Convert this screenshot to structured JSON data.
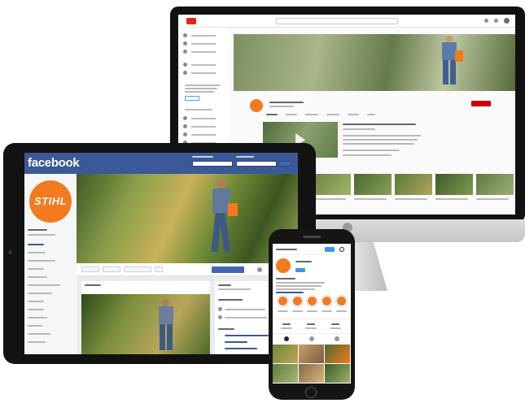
{
  "facebook": {
    "logo_text": "facebook"
  },
  "brand": {
    "badge_text": "STIHL",
    "accent_color": "#f37a1f",
    "facebook_blue": "#3b5998",
    "youtube_red": "#e62117",
    "instagram_blue": "#3897f0"
  }
}
